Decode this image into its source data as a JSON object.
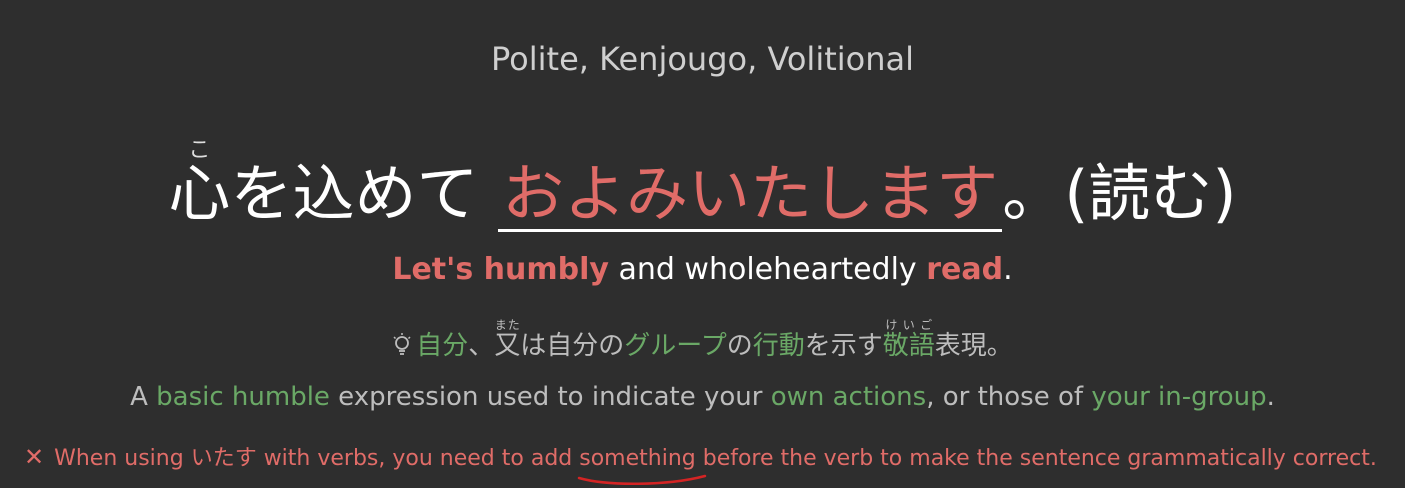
{
  "label": "Polite, Kenjougo, Volitional",
  "sentence": {
    "kanji": "心",
    "furigana": "こ",
    "middle": "を込めて",
    "answer": "およみいたします",
    "suffix": "。(読む)"
  },
  "translation": {
    "part1": "Let's humbly",
    "part2": " and wholeheartedly ",
    "part3": "read",
    "part4": "."
  },
  "hint_jp": {
    "t1": "自分",
    "t2": "、",
    "t3_base": "又",
    "t3_rt": "また",
    "t4": "は自分の",
    "t5": "グループ",
    "t6": "の",
    "t7": "行動",
    "t8": "を示す",
    "t9_base": "敬語",
    "t9_rt": "けいご",
    "t10": "表現。"
  },
  "hint_en": {
    "e1": "A ",
    "e2": "basic humble",
    "e3": " expression used to indicate your ",
    "e4": "own actions",
    "e5": ", or those of ",
    "e6": "your in-group",
    "e7": "."
  },
  "error": {
    "icon": "close-icon",
    "before": "When using いたす with verbs, you need to add ",
    "underlined": "something",
    "after": " before the verb to make the sentence grammatically correct."
  },
  "colors": {
    "background": "#2e2e2e",
    "accent_red": "#e06c68",
    "accent_green": "#6aa866"
  }
}
